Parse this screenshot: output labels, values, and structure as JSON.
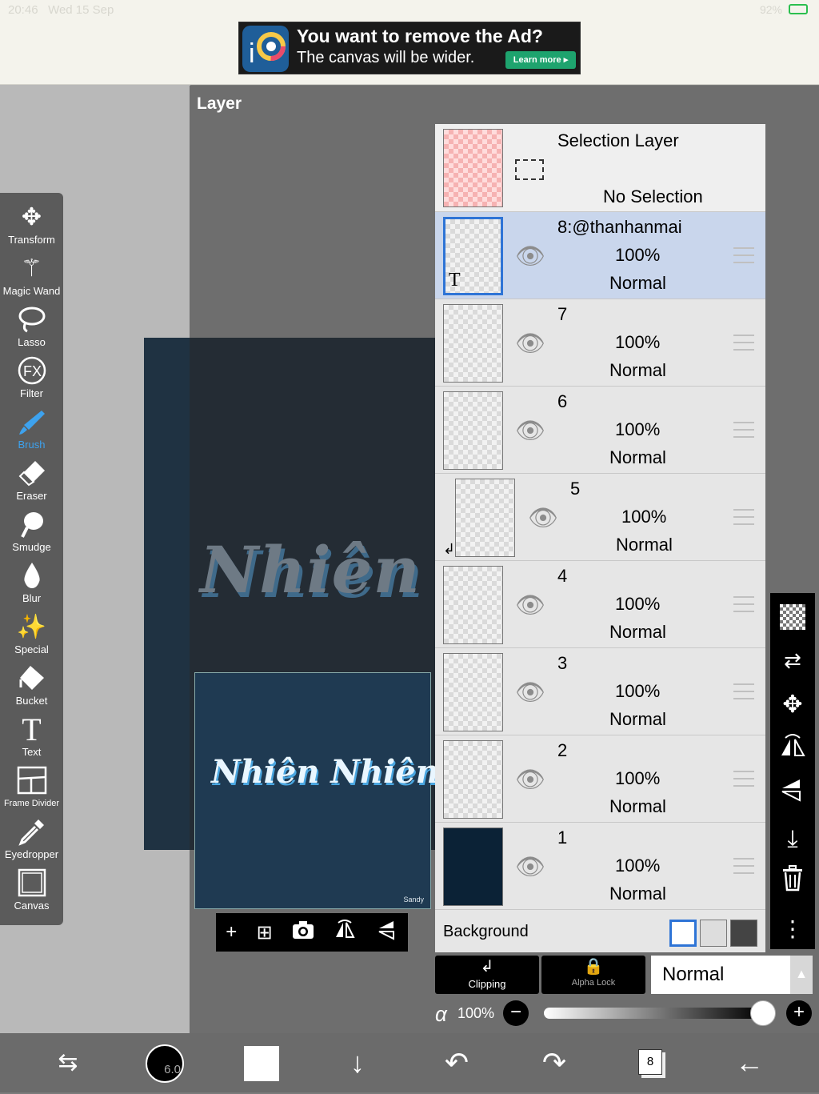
{
  "status": {
    "time": "20:46",
    "date": "Wed 15 Sep",
    "battery": "92%"
  },
  "ad": {
    "title": "You want to remove the Ad?",
    "subtitle": "The canvas will be wider.",
    "button": "Learn more ▸"
  },
  "panel": {
    "title": "Layer"
  },
  "canvas": {
    "text": "Nhiên N"
  },
  "preview": {
    "text": "Nhiên Nhiên",
    "signature": "Sandy"
  },
  "tools": [
    {
      "label": "Transform",
      "icon": "move-icon"
    },
    {
      "label": "Magic Wand",
      "icon": "magic-wand-icon"
    },
    {
      "label": "Lasso",
      "icon": "lasso-icon"
    },
    {
      "label": "Filter",
      "icon": "fx-icon"
    },
    {
      "label": "Brush",
      "icon": "brush-icon"
    },
    {
      "label": "Eraser",
      "icon": "eraser-icon"
    },
    {
      "label": "Smudge",
      "icon": "smudge-icon"
    },
    {
      "label": "Blur",
      "icon": "blur-icon"
    },
    {
      "label": "Special",
      "icon": "special-icon"
    },
    {
      "label": "Bucket",
      "icon": "bucket-icon"
    },
    {
      "label": "Text",
      "icon": "text-icon"
    },
    {
      "label": "Frame Divider",
      "icon": "frame-divider-icon"
    },
    {
      "label": "Eyedropper",
      "icon": "eyedropper-icon"
    },
    {
      "label": "Canvas",
      "icon": "canvas-icon"
    }
  ],
  "selection_layer": {
    "title": "Selection Layer",
    "status": "No Selection"
  },
  "layers": [
    {
      "name": "8:@thanhanmai",
      "opacity": "100%",
      "mode": "Normal"
    },
    {
      "name": "7",
      "opacity": "100%",
      "mode": "Normal"
    },
    {
      "name": "6",
      "opacity": "100%",
      "mode": "Normal"
    },
    {
      "name": "5",
      "opacity": "100%",
      "mode": "Normal"
    },
    {
      "name": "4",
      "opacity": "100%",
      "mode": "Normal"
    },
    {
      "name": "3",
      "opacity": "100%",
      "mode": "Normal"
    },
    {
      "name": "2",
      "opacity": "100%",
      "mode": "Normal"
    },
    {
      "name": "1",
      "opacity": "100%",
      "mode": "Normal"
    }
  ],
  "background": {
    "label": "Background"
  },
  "controls": {
    "clipping": "Clipping",
    "alpha_lock": "Alpha Lock",
    "blend_mode": "Normal",
    "alpha_symbol": "α",
    "opacity": "100%"
  },
  "bottom": {
    "brush_size": "6.0",
    "layer_count": "8"
  },
  "colors": {
    "accent": "#3da2ee",
    "selected_row": "#c9d6ec",
    "ad_button": "#1ea36e"
  }
}
